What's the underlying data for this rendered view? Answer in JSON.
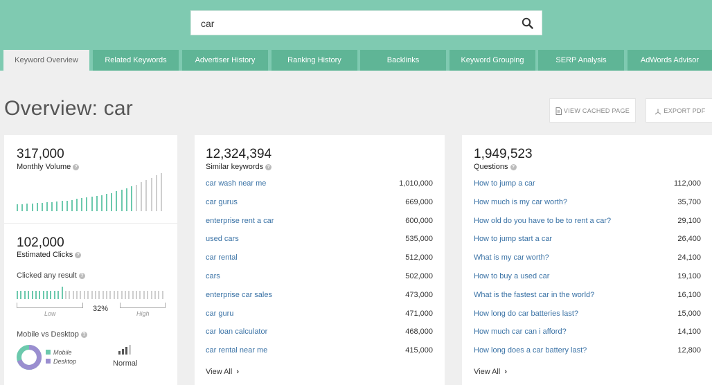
{
  "search": {
    "value": "car"
  },
  "tabs": [
    {
      "label": "Keyword Overview",
      "active": true
    },
    {
      "label": "Related Keywords"
    },
    {
      "label": "Advertiser History"
    },
    {
      "label": "Ranking History"
    },
    {
      "label": "Backlinks"
    },
    {
      "label": "Keyword Grouping"
    },
    {
      "label": "SERP Analysis"
    },
    {
      "label": "AdWords Advisor"
    }
  ],
  "page": {
    "title": "Overview: car"
  },
  "header_buttons": {
    "view_cached": "VIEW CACHED PAGE",
    "export_pdf": "EXPORT PDF"
  },
  "volume": {
    "value": "317,000",
    "label": "Monthly Volume",
    "trend_levels": [
      0.18,
      0.19,
      0.2,
      0.2,
      0.21,
      0.22,
      0.23,
      0.24,
      0.25,
      0.27,
      0.28,
      0.3,
      0.32,
      0.34,
      0.36,
      0.38,
      0.4,
      0.42,
      0.45,
      0.48,
      0.52,
      0.56,
      0.6,
      0.65,
      0.7,
      0.76,
      0.82,
      0.88,
      0.94,
      1.0
    ]
  },
  "clicks": {
    "value": "102,000",
    "label": "Estimated Clicks",
    "clicked_label": "Clicked any result",
    "percent": "32%",
    "percent_value": 0.32,
    "low": "Low",
    "high": "High"
  },
  "mobile": {
    "label": "Mobile vs Desktop",
    "mobile_label": "Mobile",
    "desktop_label": "Desktop",
    "mobile_share": 0.3,
    "status": "Normal",
    "colors": {
      "mobile": "#6cc9ad",
      "desktop": "#9a8ed0"
    }
  },
  "similar": {
    "value": "12,324,394",
    "label": "Similar keywords",
    "rows": [
      {
        "kw": "car wash near me",
        "n": "1,010,000"
      },
      {
        "kw": "car gurus",
        "n": "669,000"
      },
      {
        "kw": "enterprise rent a car",
        "n": "600,000"
      },
      {
        "kw": "used cars",
        "n": "535,000"
      },
      {
        "kw": "car rental",
        "n": "512,000"
      },
      {
        "kw": "cars",
        "n": "502,000"
      },
      {
        "kw": "enterprise car sales",
        "n": "473,000"
      },
      {
        "kw": "car guru",
        "n": "471,000"
      },
      {
        "kw": "car loan calculator",
        "n": "468,000"
      },
      {
        "kw": "car rental near me",
        "n": "415,000"
      }
    ],
    "view_all": "View All"
  },
  "questions": {
    "value": "1,949,523",
    "label": "Questions",
    "rows": [
      {
        "kw": "How to jump a car",
        "n": "112,000"
      },
      {
        "kw": "How much is my car worth?",
        "n": "35,700"
      },
      {
        "kw": "How old do you have to be to rent a car?",
        "n": "29,100"
      },
      {
        "kw": "How to jump start a car",
        "n": "26,400"
      },
      {
        "kw": "What is my car worth?",
        "n": "24,100"
      },
      {
        "kw": "How to buy a used car",
        "n": "19,100"
      },
      {
        "kw": "What is the fastest car in the world?",
        "n": "16,100"
      },
      {
        "kw": "How long do car batteries last?",
        "n": "15,000"
      },
      {
        "kw": "How much car can i afford?",
        "n": "14,100"
      },
      {
        "kw": "How long does a car battery last?",
        "n": "12,800"
      }
    ],
    "view_all": "View All"
  },
  "colors": {
    "brand": "#7fcab1",
    "tab": "#5fb596",
    "accent": "#6cc9ad",
    "link": "#3b73a6"
  }
}
